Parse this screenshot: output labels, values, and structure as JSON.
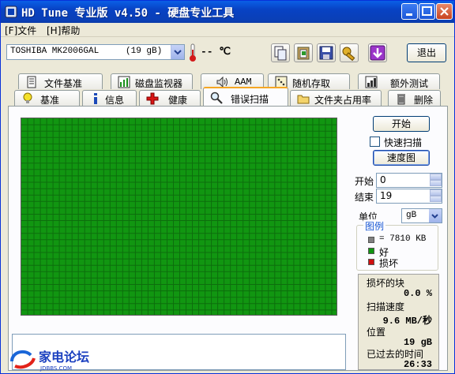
{
  "window": {
    "title": "HD Tune 专业版 v4.50 - 硬盘专业工具"
  },
  "menu": [
    {
      "label": "[F]文件"
    },
    {
      "label": "[H]帮助"
    }
  ],
  "toolbar": {
    "drive": "TOSHIBA MK2006GAL",
    "drive_size": "(19 gB)",
    "temperature": "-- ℃",
    "exit_label": "退出"
  },
  "tabs_top": [
    {
      "label": "文件基准",
      "icon": "document-icon"
    },
    {
      "label": "磁盘监视器",
      "icon": "bar-chart-icon"
    },
    {
      "label": "AAM",
      "icon": "speaker-icon"
    },
    {
      "label": "随机存取",
      "icon": "dice-icon"
    },
    {
      "label": "额外测试",
      "icon": "grid-chart-icon"
    }
  ],
  "tabs_bottom": [
    {
      "label": "基准",
      "icon": "lightbulb-icon"
    },
    {
      "label": "信息",
      "icon": "info-icon"
    },
    {
      "label": "健康",
      "icon": "red-cross-icon"
    },
    {
      "label": "错误扫描",
      "icon": "magnifier-icon",
      "active": true
    },
    {
      "label": "文件夹占用率",
      "icon": "folder-icon"
    },
    {
      "label": "删除",
      "icon": "trash-icon"
    }
  ],
  "scan": {
    "start_button": "开始",
    "quick_scan_label": "快速扫描",
    "quick_scan_checked": false,
    "map_button": "速度图",
    "start_label": "开始",
    "start_value": "0",
    "end_label": "结束",
    "end_value": "19",
    "unit_label": "单位",
    "unit_value": "gB"
  },
  "legend": {
    "title": "图例",
    "block_size": "= 7810 KB",
    "good_label": "好",
    "bad_label": "损坏",
    "good_color": "#119611",
    "bad_color": "#d01010"
  },
  "stats": {
    "damaged_label": "损坏的块",
    "damaged_value": "0.0 %",
    "speed_label": "扫描速度",
    "speed_value": "9.6 MB/秒",
    "position_label": "位置",
    "position_value": "19 gB",
    "elapsed_label": "已过去的时间",
    "elapsed_value": "26:33"
  },
  "watermark": {
    "text": "家电论坛",
    "sub": "JDBBS.COM"
  }
}
